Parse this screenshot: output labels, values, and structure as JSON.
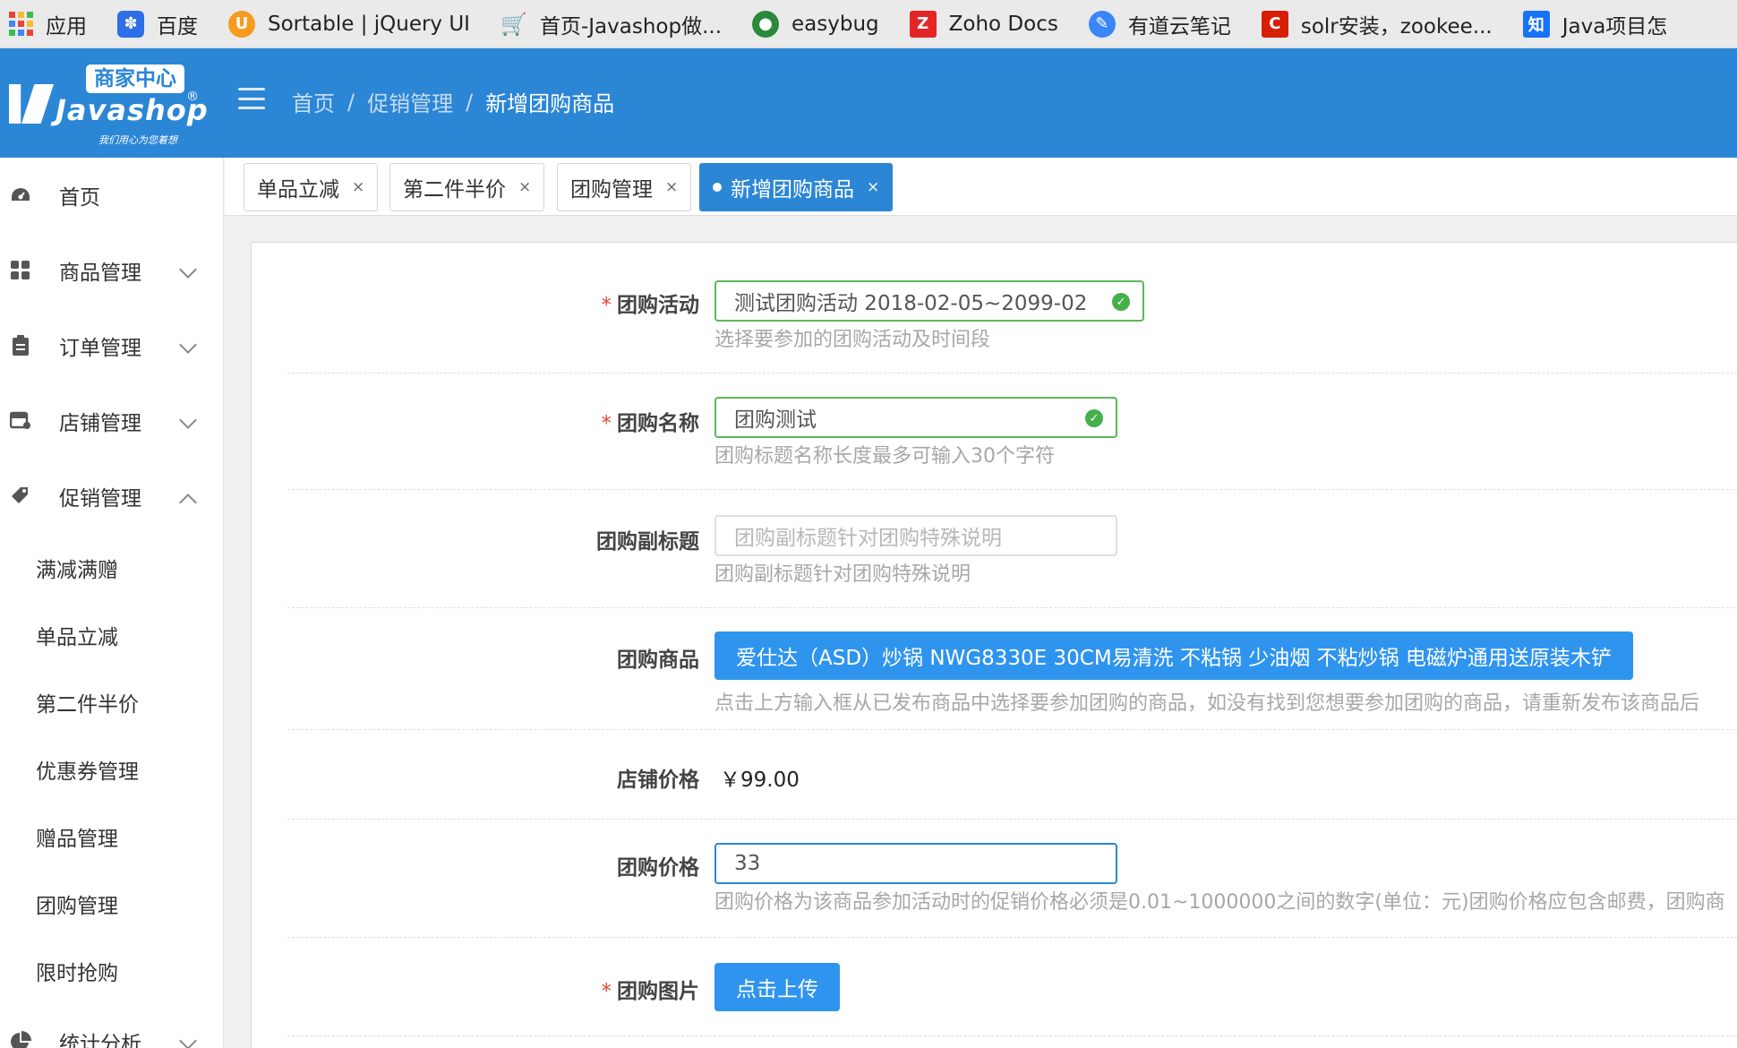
{
  "bookmarks": [
    {
      "label": "应用",
      "icon": "apps-grid-icon"
    },
    {
      "label": "百度",
      "icon": "baidu-paw-icon",
      "color": "#2e6ee6"
    },
    {
      "label": "Sortable | jQuery UI",
      "icon": "jquery-ui-icon",
      "color": "#f79a1e"
    },
    {
      "label": "首页-Javashop做...",
      "icon": "shopping-cart-icon",
      "color": "#2b86d6"
    },
    {
      "label": "easybug",
      "icon": "easybug-bug-icon",
      "color": "#2a8a3a"
    },
    {
      "label": "Zoho Docs",
      "icon": "zoho-docs-icon",
      "color": "#e42527"
    },
    {
      "label": "有道云笔记",
      "icon": "youdao-note-icon",
      "color": "#3a86f7"
    },
    {
      "label": "solr安装，zookee...",
      "icon": "csdn-c-icon",
      "color": "#d81e06"
    },
    {
      "label": "Java项目怎",
      "icon": "zhihu-icon",
      "color": "#1772f6"
    }
  ],
  "logo": {
    "badge": "商家中心",
    "name": "Javashop",
    "reg": "®",
    "slogan": "我们用心为您着想"
  },
  "breadcrumb": {
    "home": "首页",
    "section": "促销管理",
    "current": "新增团购商品",
    "separator": "/"
  },
  "sidebar": {
    "items": [
      {
        "label": "首页",
        "icon": "dashboard-icon"
      },
      {
        "label": "商品管理",
        "icon": "goods-grid-icon"
      },
      {
        "label": "订单管理",
        "icon": "clipboard-icon"
      },
      {
        "label": "店铺管理",
        "icon": "store-icon"
      },
      {
        "label": "促销管理",
        "icon": "tag-icon"
      }
    ],
    "submenu": [
      "满减满赠",
      "单品立减",
      "第二件半价",
      "优惠券管理",
      "赠品管理",
      "团购管理",
      "限时抢购"
    ],
    "bottom_item": {
      "label": "统计分析",
      "icon": "pie-chart-icon"
    }
  },
  "tabs": [
    {
      "label": "单品立减",
      "close": "×"
    },
    {
      "label": "第二件半价",
      "close": "×"
    },
    {
      "label": "团购管理",
      "close": "×"
    },
    {
      "label": "新增团购商品",
      "close": "×",
      "active": true
    }
  ],
  "form": {
    "activity": {
      "label": "团购活动",
      "required": "*",
      "value": "测试团购活动   2018-02-05~2099-02",
      "help": "选择要参加的团购活动及时间段"
    },
    "name": {
      "label": "团购名称",
      "required": "*",
      "value": "团购测试",
      "help": "团购标题名称长度最多可输入30个字符"
    },
    "subtitle": {
      "label": "团购副标题",
      "placeholder": "团购副标题针对团购特殊说明",
      "help": "团购副标题针对团购特殊说明"
    },
    "goods": {
      "label": "团购商品",
      "value": "爱仕达（ASD）炒锅 NWG8330E 30CM易清洗 不粘锅 少油烟 不粘炒锅 电磁炉通用送原装木铲",
      "help": "点击上方输入框从已发布商品中选择要参加团购的商品，如没有找到您想要参加团购的商品，请重新发布该商品后"
    },
    "store_price": {
      "label": "店铺价格",
      "value": "￥99.00"
    },
    "group_price": {
      "label": "团购价格",
      "value": "33",
      "help": "团购价格为该商品参加活动时的促销价格必须是0.01~1000000之间的数字(单位：元)团购价格应包含邮费，团购商"
    },
    "image": {
      "label": "团购图片",
      "required": "*",
      "button": "点击上传"
    }
  },
  "colors": {
    "primary": "#2b86d6",
    "success": "#46b04a",
    "required": "#e6463a"
  }
}
